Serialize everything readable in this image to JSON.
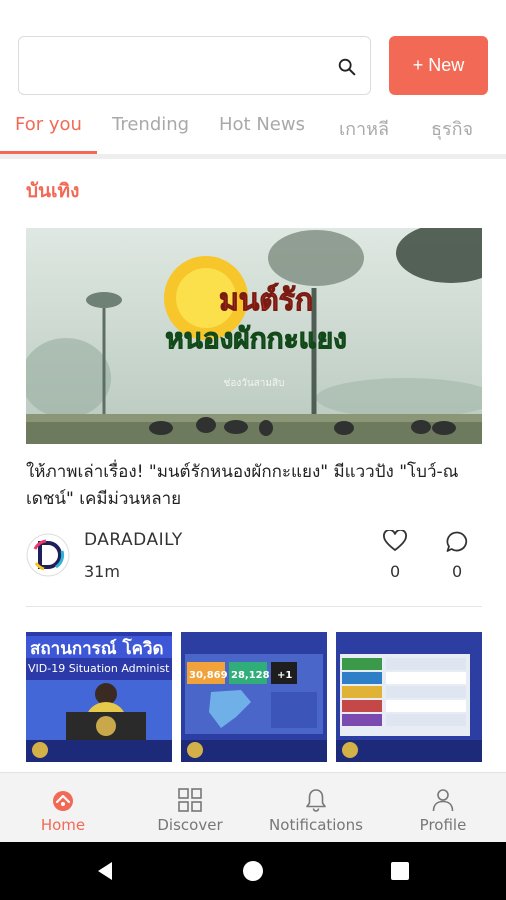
{
  "search": {
    "value": "",
    "placeholder": ""
  },
  "new_button": {
    "label": "+ New"
  },
  "tabs": [
    {
      "label": "For you",
      "active": true
    },
    {
      "label": "Trending",
      "active": false
    },
    {
      "label": "Hot News",
      "active": false
    },
    {
      "label": "เกาหลี",
      "active": false
    },
    {
      "label": "ธุรกิจ",
      "active": false
    }
  ],
  "section": {
    "title": "บันเทิง"
  },
  "article": {
    "hero_title_line1": "มนต์รัก",
    "hero_title_line2": "หนองผักกะแยง",
    "hero_caption": "ช่องวันสามสิบ",
    "headline": "ให้ภาพเล่าเรื่อง! \"มนต์รักหนองผักกะแยง\" มีแววปัง \"โบว์-ณเดชน์\" เคมีม่วนหลาย",
    "source": "DARADAILY",
    "time": "31m",
    "likes": "0",
    "comments": "0"
  },
  "thumbnails": [
    {
      "banner": "สถานการณ์ โควิด",
      "sub": "VID-19 Situation Administ"
    },
    {
      "n1": "30,869",
      "n2": "28,128",
      "n3": "+1"
    },
    {
      "label": ""
    }
  ],
  "bottom_nav": [
    {
      "label": "Home",
      "icon": "home-icon",
      "active": true
    },
    {
      "label": "Discover",
      "icon": "grid-icon",
      "active": false
    },
    {
      "label": "Notifications",
      "icon": "bell-icon",
      "active": false
    },
    {
      "label": "Profile",
      "icon": "user-icon",
      "active": false
    }
  ],
  "colors": {
    "accent": "#f26a55",
    "inactive": "#a9a9a9",
    "nav_bg": "#f3f3f3"
  }
}
